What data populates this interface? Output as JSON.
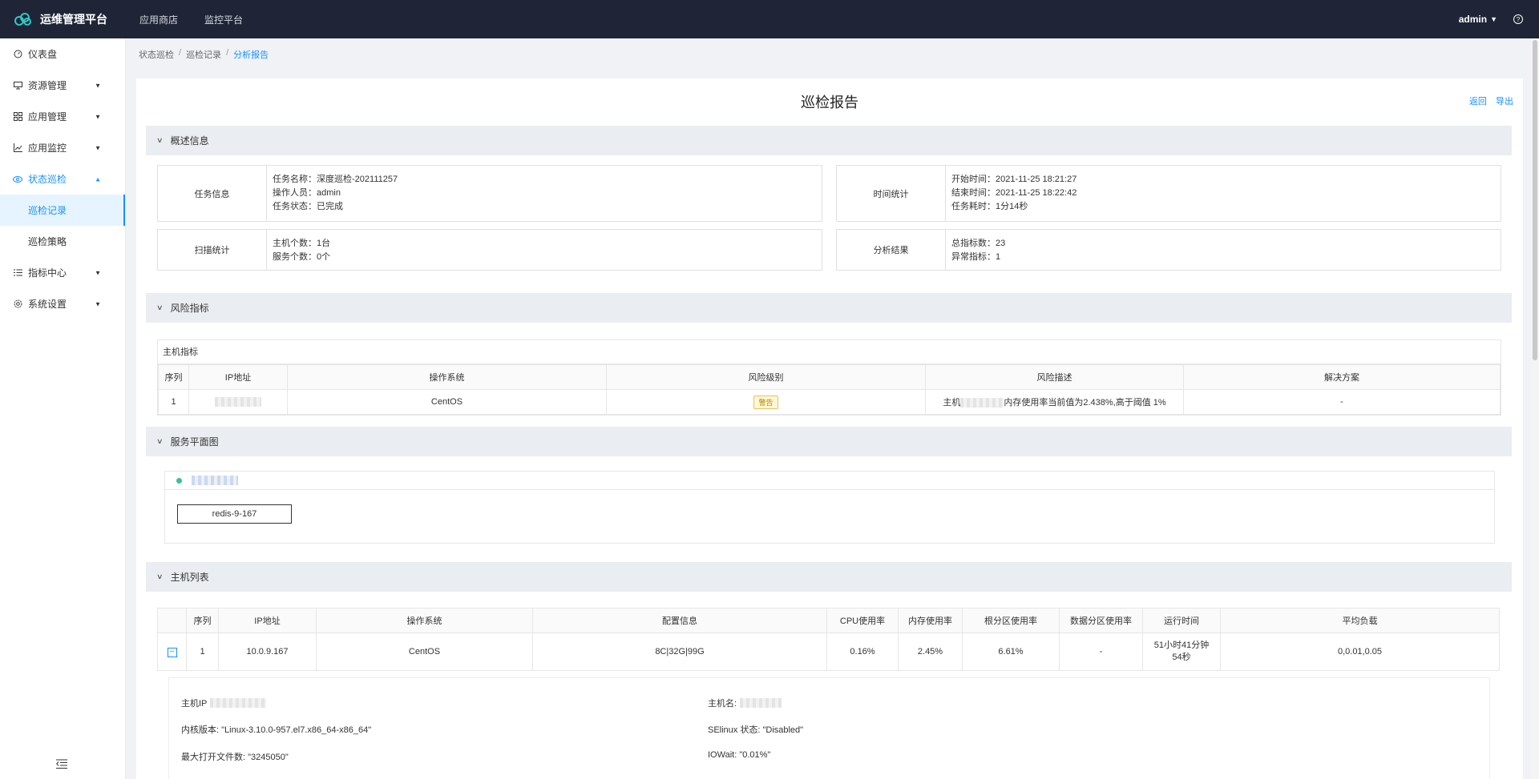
{
  "header": {
    "app_title": "运维管理平台",
    "nav": [
      "应用商店",
      "监控平台"
    ],
    "user": "admin"
  },
  "sidebar": {
    "items": [
      {
        "label": "仪表盘",
        "icon": "dashboard-icon"
      },
      {
        "label": "资源管理",
        "icon": "monitor-icon"
      },
      {
        "label": "应用管理",
        "icon": "apps-icon"
      },
      {
        "label": "应用监控",
        "icon": "line-chart-icon"
      },
      {
        "label": "状态巡检",
        "icon": "eye-icon"
      },
      {
        "label": "指标中心",
        "icon": "list-icon"
      },
      {
        "label": "系统设置",
        "icon": "gear-icon"
      }
    ],
    "sub_items": [
      "巡检记录",
      "巡检策略"
    ]
  },
  "breadcrumb": [
    "状态巡检",
    "巡检记录",
    "分析报告"
  ],
  "report": {
    "title": "巡检报告",
    "actions": [
      "返回",
      "导出"
    ]
  },
  "sections": {
    "overview": "概述信息",
    "risk": "风险指标",
    "service_map": "服务平面图",
    "host_list": "主机列表"
  },
  "overview": {
    "task_label": "任务信息",
    "task_lines": [
      "任务名称：深度巡检-202111257",
      "操作人员：admin",
      "任务状态：已完成"
    ],
    "time_label": "时间统计",
    "time_lines": [
      "开始时间：2021-11-25 18:21:27",
      "结束时间：2021-11-25 18:22:42",
      "任务耗时：1分14秒"
    ],
    "scan_label": "扫描统计",
    "scan_lines": [
      "主机个数：1台",
      "服务个数：0个"
    ],
    "result_label": "分析结果",
    "result_lines": [
      "总指标数：23",
      "异常指标：1"
    ]
  },
  "risk_table": {
    "caption": "主机指标",
    "headers": [
      "序列",
      "IP地址",
      "操作系统",
      "风险级别",
      "风险描述",
      "解决方案"
    ],
    "row": {
      "index": "1",
      "os": "CentOS",
      "level": "警告",
      "desc_prefix": "主机",
      "desc_suffix": "内存使用率当前值为2.438%,高于阈值 1%",
      "solution": "-"
    }
  },
  "service_map": {
    "node": "redis-9-167"
  },
  "host_table": {
    "headers": [
      "",
      "序列",
      "IP地址",
      "操作系统",
      "配置信息",
      "CPU使用率",
      "内存使用率",
      "根分区使用率",
      "数据分区使用率",
      "运行时间",
      "平均负载"
    ],
    "row": {
      "expand": "−",
      "index": "1",
      "ip": "10.0.9.167",
      "os": "CentOS",
      "config": "8C|32G|99G",
      "cpu": "0.16%",
      "mem": "2.45%",
      "root": "6.61%",
      "data": "-",
      "uptime_1": "51小时41分钟",
      "uptime_2": "54秒",
      "load": "0,0.01,0.05"
    }
  },
  "host_detail": {
    "host_ip_label": "主机IP",
    "hostname_label": "主机名:",
    "kernel": "内核版本: \"Linux-3.10.0-957.el7.x86_64-x86_64\"",
    "selinux": "SElinux 状态: \"Disabled\"",
    "max_files": "最大打开文件数: \"3245050\"",
    "iowait": "IOWait: \"0.01%\""
  },
  "colors": {
    "topbar": "#1f2537",
    "accent": "#1890ff",
    "status_dot": "#3bbf9a"
  }
}
